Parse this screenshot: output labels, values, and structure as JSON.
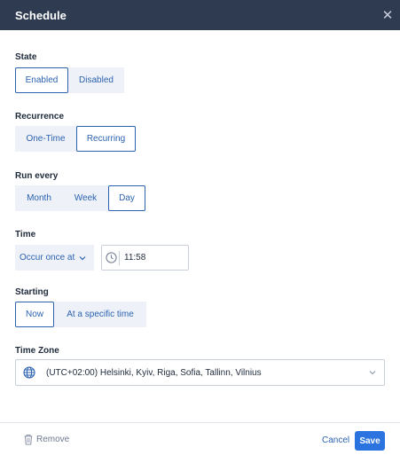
{
  "dialog": {
    "title": "Schedule",
    "close_icon": "close-icon"
  },
  "state": {
    "label": "State",
    "options": [
      "Enabled",
      "Disabled"
    ],
    "selected": "Enabled"
  },
  "recurrence": {
    "label": "Recurrence",
    "options": [
      "One-Time",
      "Recurring"
    ],
    "selected": "Recurring"
  },
  "run_every": {
    "label": "Run every",
    "options": [
      "Month",
      "Week",
      "Day"
    ],
    "selected": "Day"
  },
  "time": {
    "label": "Time",
    "mode_select_value": "Occur once at",
    "value": "11:58",
    "clock_icon": "clock-icon"
  },
  "starting": {
    "label": "Starting",
    "options": [
      "Now",
      "At a specific time"
    ],
    "selected": "Now"
  },
  "time_zone": {
    "label": "Time Zone",
    "value": "(UTC+02:00) Helsinki, Kyiv, Riga, Sofia, Tallinn, Vilnius",
    "globe_icon": "globe-icon"
  },
  "footer": {
    "remove_label": "Remove",
    "cancel_label": "Cancel",
    "save_label": "Save"
  },
  "colors": {
    "header_bg": "#2f3b51",
    "accent": "#2b62b0",
    "primary_button": "#2b74e0",
    "segment_bg": "#eef2f8"
  }
}
